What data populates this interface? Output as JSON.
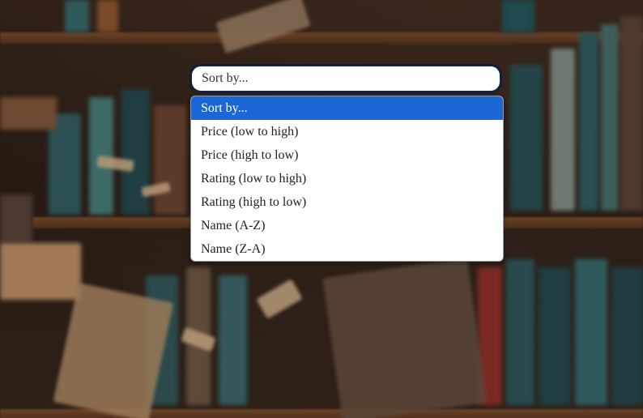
{
  "sort_select": {
    "current_value": "Sort by...",
    "options": [
      {
        "label": "Sort by...",
        "selected": true
      },
      {
        "label": "Price (low to high)",
        "selected": false
      },
      {
        "label": "Price (high to low)",
        "selected": false
      },
      {
        "label": "Rating (low to high)",
        "selected": false
      },
      {
        "label": "Rating (high to low)",
        "selected": false
      },
      {
        "label": "Name (A-Z)",
        "selected": false
      },
      {
        "label": "Name (Z-A)",
        "selected": false
      }
    ]
  },
  "colors": {
    "highlight": "#1b67d6",
    "select_border": "#12244a"
  }
}
